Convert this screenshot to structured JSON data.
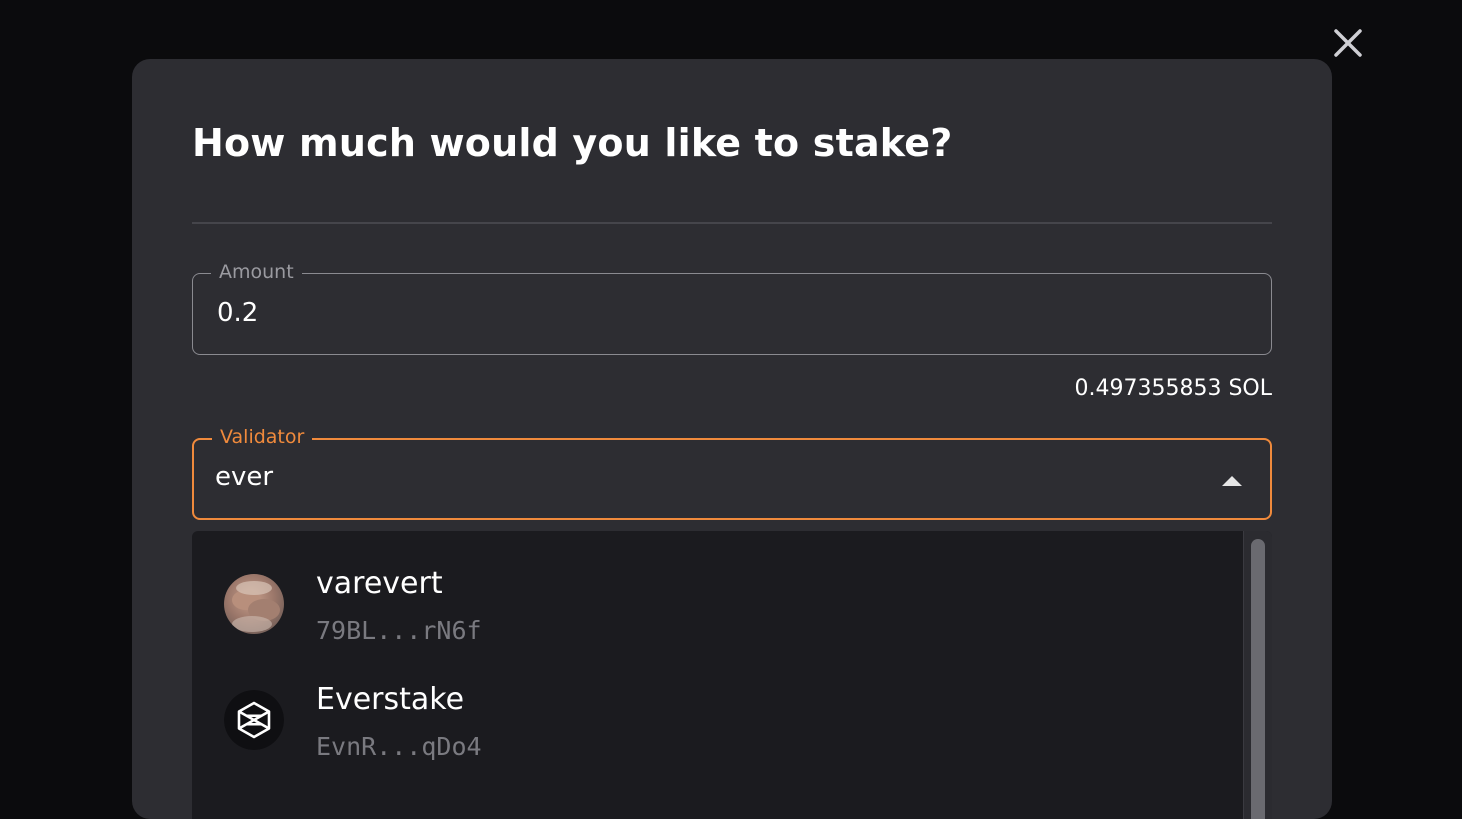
{
  "close_icon": "close-icon",
  "modal": {
    "title": "How much would you like to stake?",
    "amount_field": {
      "label": "Amount",
      "value": "0.2"
    },
    "balance": "0.497355853 SOL",
    "validator_field": {
      "label": "Validator",
      "value": "ever",
      "arrow_icon": "caret-up-icon"
    },
    "accent_color": "#f08a3c",
    "validator_options": [
      {
        "name": "varevert",
        "address": "79BL...rN6f",
        "avatar": "photo-avatar"
      },
      {
        "name": "Everstake",
        "address": "EvnR...qDo4",
        "avatar": "everstake-logo-icon"
      }
    ]
  }
}
